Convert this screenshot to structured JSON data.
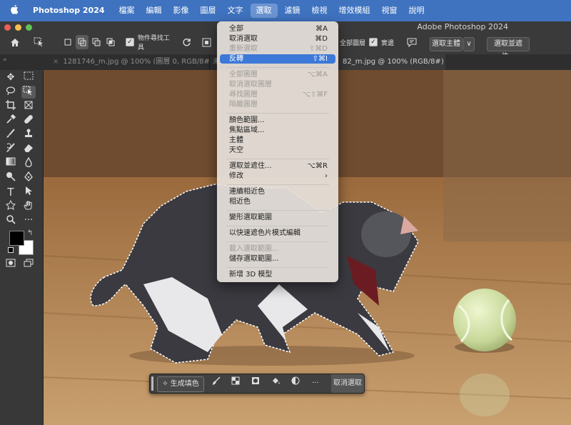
{
  "menubar": {
    "apple": "",
    "app_name": "Photoshop 2024",
    "items": [
      "檔案",
      "編輯",
      "影像",
      "圖層",
      "文字",
      "選取",
      "濾鏡",
      "檢視",
      "增效模組",
      "視窗",
      "說明"
    ]
  },
  "window": {
    "title": "Adobe Photoshop 2024"
  },
  "options_bar": {
    "object_finder_label": "物件尋找工具",
    "sample_all_layers_label": "全部圖層",
    "enhance_edge_label": "實邊",
    "select_subject_label": "選取主體",
    "select_and_mask_label": "選取並遮住...",
    "dropdown_chevron": "∨"
  },
  "tabs": [
    {
      "label": "1281746_m.jpg @ 100% (圖層 0, RGB/8#) *"
    },
    {
      "label": "未"
    },
    {
      "label": "82_m.jpg @ 100% (RGB/8#) *"
    }
  ],
  "select_menu": {
    "items": [
      {
        "label": "全部",
        "shortcut": "⌘A",
        "enabled": true
      },
      {
        "label": "取消選取",
        "shortcut": "⌘D",
        "enabled": true
      },
      {
        "label": "重新選取",
        "shortcut": "⇧⌘D",
        "enabled": false
      },
      {
        "label": "反轉",
        "shortcut": "⇧⌘I",
        "enabled": true,
        "highlighted": true
      },
      {
        "label": "全部圖層",
        "shortcut": "⌥⌘A",
        "enabled": false
      },
      {
        "label": "取消選取圖層",
        "shortcut": "",
        "enabled": false
      },
      {
        "label": "尋找圖層",
        "shortcut": "⌥⇧⌘F",
        "enabled": false
      },
      {
        "label": "隔離圖層",
        "shortcut": "",
        "enabled": false
      },
      {
        "label": "顏色範圍...",
        "shortcut": "",
        "enabled": true
      },
      {
        "label": "焦點區域...",
        "shortcut": "",
        "enabled": true
      },
      {
        "label": "主體",
        "shortcut": "",
        "enabled": true
      },
      {
        "label": "天空",
        "shortcut": "",
        "enabled": true
      },
      {
        "label": "選取並遮住...",
        "shortcut": "⌥⌘R",
        "enabled": true
      },
      {
        "label": "修改",
        "shortcut": "›",
        "enabled": true
      },
      {
        "label": "連續相近色",
        "shortcut": "",
        "enabled": true
      },
      {
        "label": "相近色",
        "shortcut": "",
        "enabled": true
      },
      {
        "label": "變形選取範圍",
        "shortcut": "",
        "enabled": true
      },
      {
        "label": "以快速遮色片模式編輯",
        "shortcut": "",
        "enabled": true
      },
      {
        "label": "載入選取範圍...",
        "shortcut": "",
        "enabled": false
      },
      {
        "label": "儲存選取範圍...",
        "shortcut": "",
        "enabled": true
      },
      {
        "label": "新增 3D 模型",
        "shortcut": "",
        "enabled": true
      }
    ]
  },
  "context_bar": {
    "generative_fill_label": "生成填色",
    "deselect_label": "取消選取",
    "more_label": "···"
  },
  "colors": {
    "menubar": "#3f73c0",
    "highlight": "#3c78d8"
  }
}
